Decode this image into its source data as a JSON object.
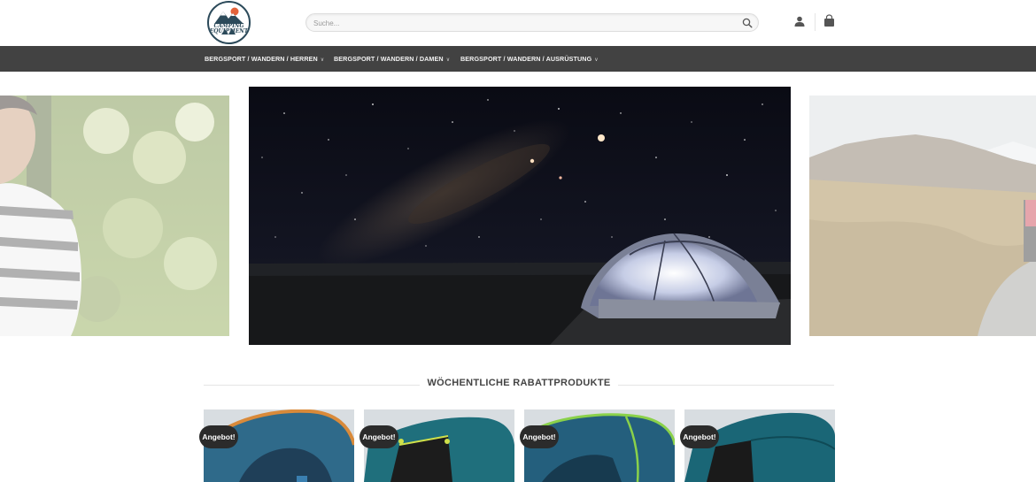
{
  "logo": {
    "line1": "CAMPING",
    "line2": "EQUIPMENT"
  },
  "search": {
    "placeholder": "Suche..."
  },
  "icons": {
    "search": "search-icon",
    "user": "user-icon",
    "cart": "shopping-bag-icon"
  },
  "nav": {
    "items": [
      {
        "label": "BERGSPORT / WANDERN / HERREN"
      },
      {
        "label": "BERGSPORT / WANDERN / DAMEN"
      },
      {
        "label": "BERGSPORT / WANDERN / AUSRÜSTUNG"
      }
    ]
  },
  "section": {
    "title": "WÖCHENTLICHE RABATTPRODUKTE"
  },
  "products": [
    {
      "badge": "Angebot!"
    },
    {
      "badge": "Angebot!"
    },
    {
      "badge": "Angebot!"
    },
    {
      "badge": "Angebot!"
    }
  ],
  "colors": {
    "nav_bg": "#424242",
    "badge_bg": "#2b2b2b"
  }
}
